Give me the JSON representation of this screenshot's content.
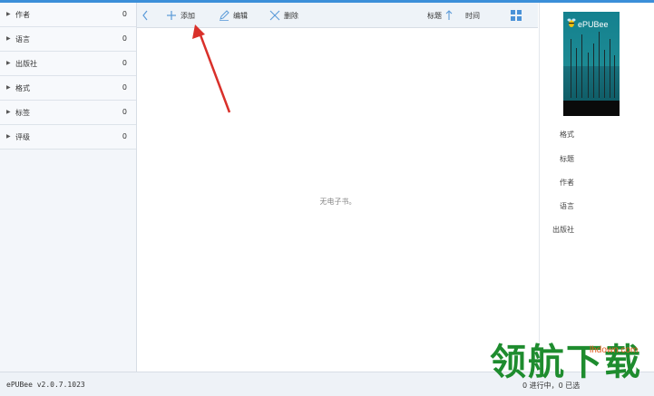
{
  "sidebar": {
    "items": [
      {
        "label": "作者",
        "count": "0"
      },
      {
        "label": "语言",
        "count": "0"
      },
      {
        "label": "出版社",
        "count": "0"
      },
      {
        "label": "格式",
        "count": "0"
      },
      {
        "label": "标签",
        "count": "0"
      },
      {
        "label": "评级",
        "count": "0"
      }
    ]
  },
  "toolbar": {
    "add_label": "添加",
    "edit_label": "编辑",
    "delete_label": "删除",
    "sort_title_label": "标题",
    "sort_time_label": "时间"
  },
  "main": {
    "empty_text": "无电子书。"
  },
  "detail": {
    "cover_brand": "ePUBee",
    "fields": [
      "格式",
      "标题",
      "作者",
      "语言",
      "出版社"
    ]
  },
  "statusbar": {
    "version": "ePUBee v2.0.7.1023",
    "right_text": "0 进行中，0 已选"
  },
  "watermark": {
    "text": "领航下载",
    "url": "lhdown.com"
  },
  "colors": {
    "accent": "#3b8fd9",
    "icon": "#5a9ad8",
    "arrow": "#d9302a",
    "watermark_green": "#1e8c2e",
    "watermark_orange": "#e25d20"
  }
}
